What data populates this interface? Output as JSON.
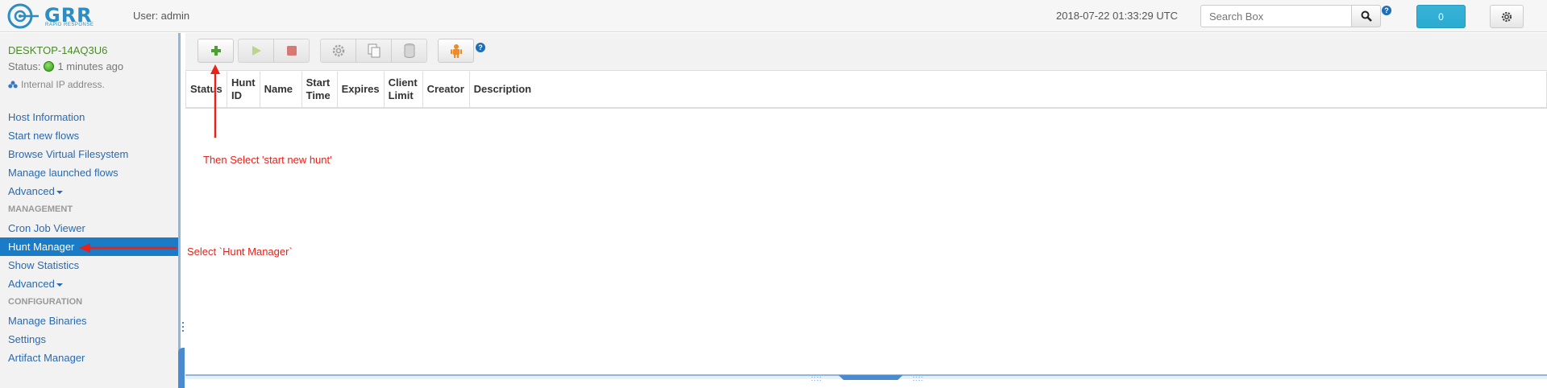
{
  "header": {
    "logo_text": "GRR",
    "logo_subtitle": "RAPID RESPONSE",
    "user_label": "User: admin",
    "clock": "2018-07-22 01:33:29 UTC",
    "search_placeholder": "Search Box",
    "help_glyph": "?",
    "notification_count": "0"
  },
  "client": {
    "name": "DESKTOP-14AQ3U6",
    "status": "Status:",
    "last_seen": "1 minutes ago",
    "ip": "Internal IP address."
  },
  "sidebar": {
    "items": [
      {
        "label": "Host Information"
      },
      {
        "label": "Start new flows"
      },
      {
        "label": "Browse Virtual Filesystem"
      },
      {
        "label": "Manage launched flows"
      },
      {
        "label": "Advanced"
      },
      {
        "label": "Cron Job Viewer"
      },
      {
        "label": "Hunt Manager"
      },
      {
        "label": "Show Statistics"
      },
      {
        "label": "Advanced"
      },
      {
        "label": "Manage Binaries"
      },
      {
        "label": "Settings"
      },
      {
        "label": "Artifact Manager"
      }
    ],
    "section_management": "MANAGEMENT",
    "section_configuration": "CONFIGURATION"
  },
  "toolbar": {
    "buttons": [
      "plus-icon",
      "play-icon",
      "stop-icon",
      "gear-icon",
      "copy-icon",
      "database-icon",
      "robot-icon"
    ]
  },
  "table": {
    "headers": [
      {
        "line1": "Status",
        "line2": ""
      },
      {
        "line1": "Hunt",
        "line2": "ID"
      },
      {
        "line1": "Name",
        "line2": ""
      },
      {
        "line1": "Start",
        "line2": "Time"
      },
      {
        "line1": "Expires",
        "line2": ""
      },
      {
        "line1": "Client",
        "line2": "Limit"
      },
      {
        "line1": "Creator",
        "line2": ""
      },
      {
        "line1": "Description",
        "line2": ""
      }
    ]
  },
  "annotations": {
    "start_new_hunt": "Then Select 'start new hunt'",
    "hunt_manager": "Select `Hunt Manager`"
  },
  "colors": {
    "accent": "#1a7bc6",
    "annotation": "#e8221a",
    "client_name": "#4a8a2a"
  }
}
